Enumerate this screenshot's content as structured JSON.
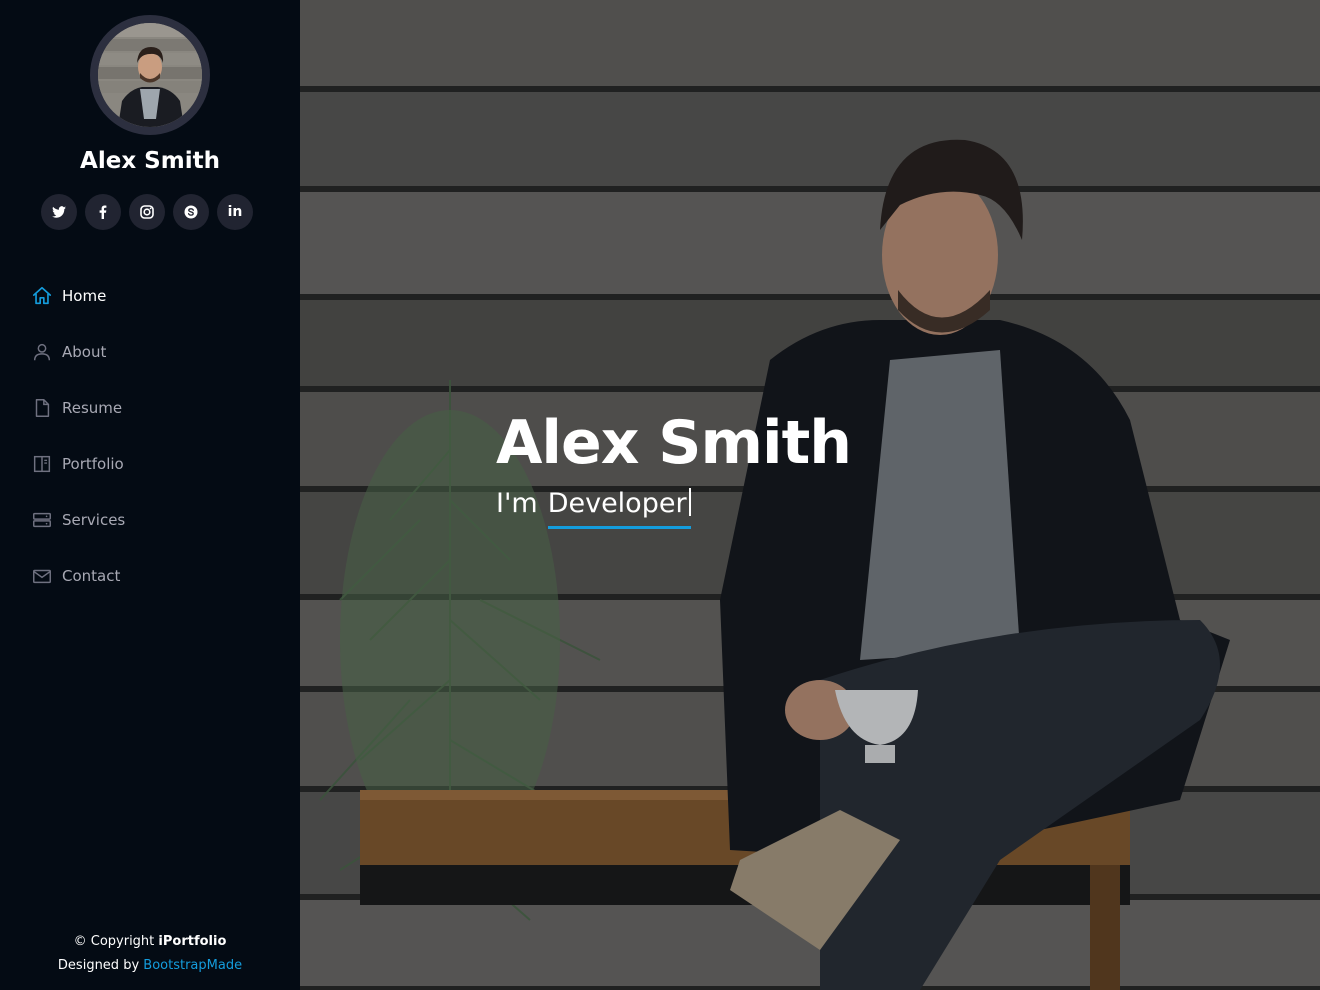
{
  "profile": {
    "name": "Alex Smith"
  },
  "social": [
    {
      "icon": "twitter-icon",
      "label": ""
    },
    {
      "icon": "facebook-icon",
      "label": ""
    },
    {
      "icon": "instagram-icon",
      "label": ""
    },
    {
      "icon": "skype-icon",
      "label": ""
    },
    {
      "icon": "linkedin-icon",
      "label": "in"
    }
  ],
  "nav": {
    "items": [
      {
        "label": "Home",
        "icon": "home-icon",
        "active": true
      },
      {
        "label": "About",
        "icon": "person-icon",
        "active": false
      },
      {
        "label": "Resume",
        "icon": "file-icon",
        "active": false
      },
      {
        "label": "Portfolio",
        "icon": "book-half-icon",
        "active": false
      },
      {
        "label": "Services",
        "icon": "server-icon",
        "active": false
      },
      {
        "label": "Contact",
        "icon": "envelope-icon",
        "active": false
      }
    ]
  },
  "footer": {
    "copyright_prefix": "© Copyright",
    "brand": "iPortfolio",
    "designed_by_prefix": "Designed by",
    "designed_by_link": "BootstrapMade"
  },
  "hero": {
    "title": "Alex Smith",
    "subtitle_prefix": "I'm",
    "typed_text": "Developer"
  },
  "colors": {
    "sidebar_bg": "#040b14",
    "accent": "#149ddd",
    "social_bg": "#212431",
    "avatar_border": "#2c2f3f"
  }
}
